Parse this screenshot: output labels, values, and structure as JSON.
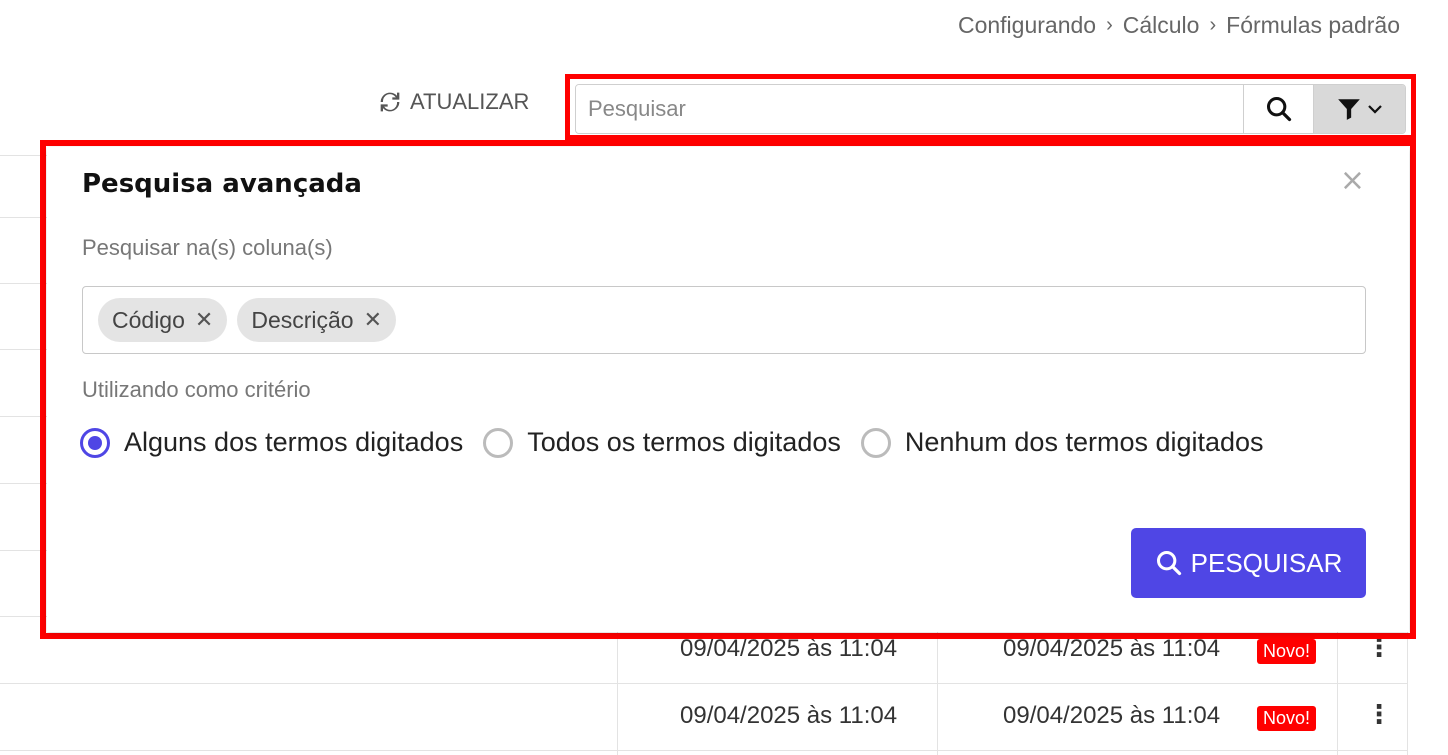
{
  "breadcrumb": [
    "Configurando",
    "Cálculo",
    "Fórmulas padrão"
  ],
  "toolbar": {
    "refresh_label": "ATUALIZAR",
    "search_placeholder": "Pesquisar"
  },
  "advanced_search": {
    "title": "Pesquisa avançada",
    "close_label": "×",
    "columns_label": "Pesquisar na(s) coluna(s)",
    "selected_columns": [
      "Código",
      "Descrição"
    ],
    "criteria_label": "Utilizando como critério",
    "criteria_options": [
      {
        "label": "Alguns dos termos digitados",
        "checked": true
      },
      {
        "label": "Todos os termos digitados",
        "checked": false
      },
      {
        "label": "Nenhum dos termos digitados",
        "checked": false
      }
    ],
    "submit_label": "PESQUISAR"
  },
  "table": {
    "rows": [
      {
        "created": "09/04/2025 às 11:04",
        "updated": "09/04/2025 às 11:04",
        "badge": "Novo!"
      },
      {
        "created": "09/04/2025 às 11:04",
        "updated": "09/04/2025 às 11:04",
        "badge": "Novo!"
      }
    ]
  },
  "colors": {
    "accent": "#4f46e5",
    "highlight": "#ff0000",
    "badge": "#ff0000"
  }
}
